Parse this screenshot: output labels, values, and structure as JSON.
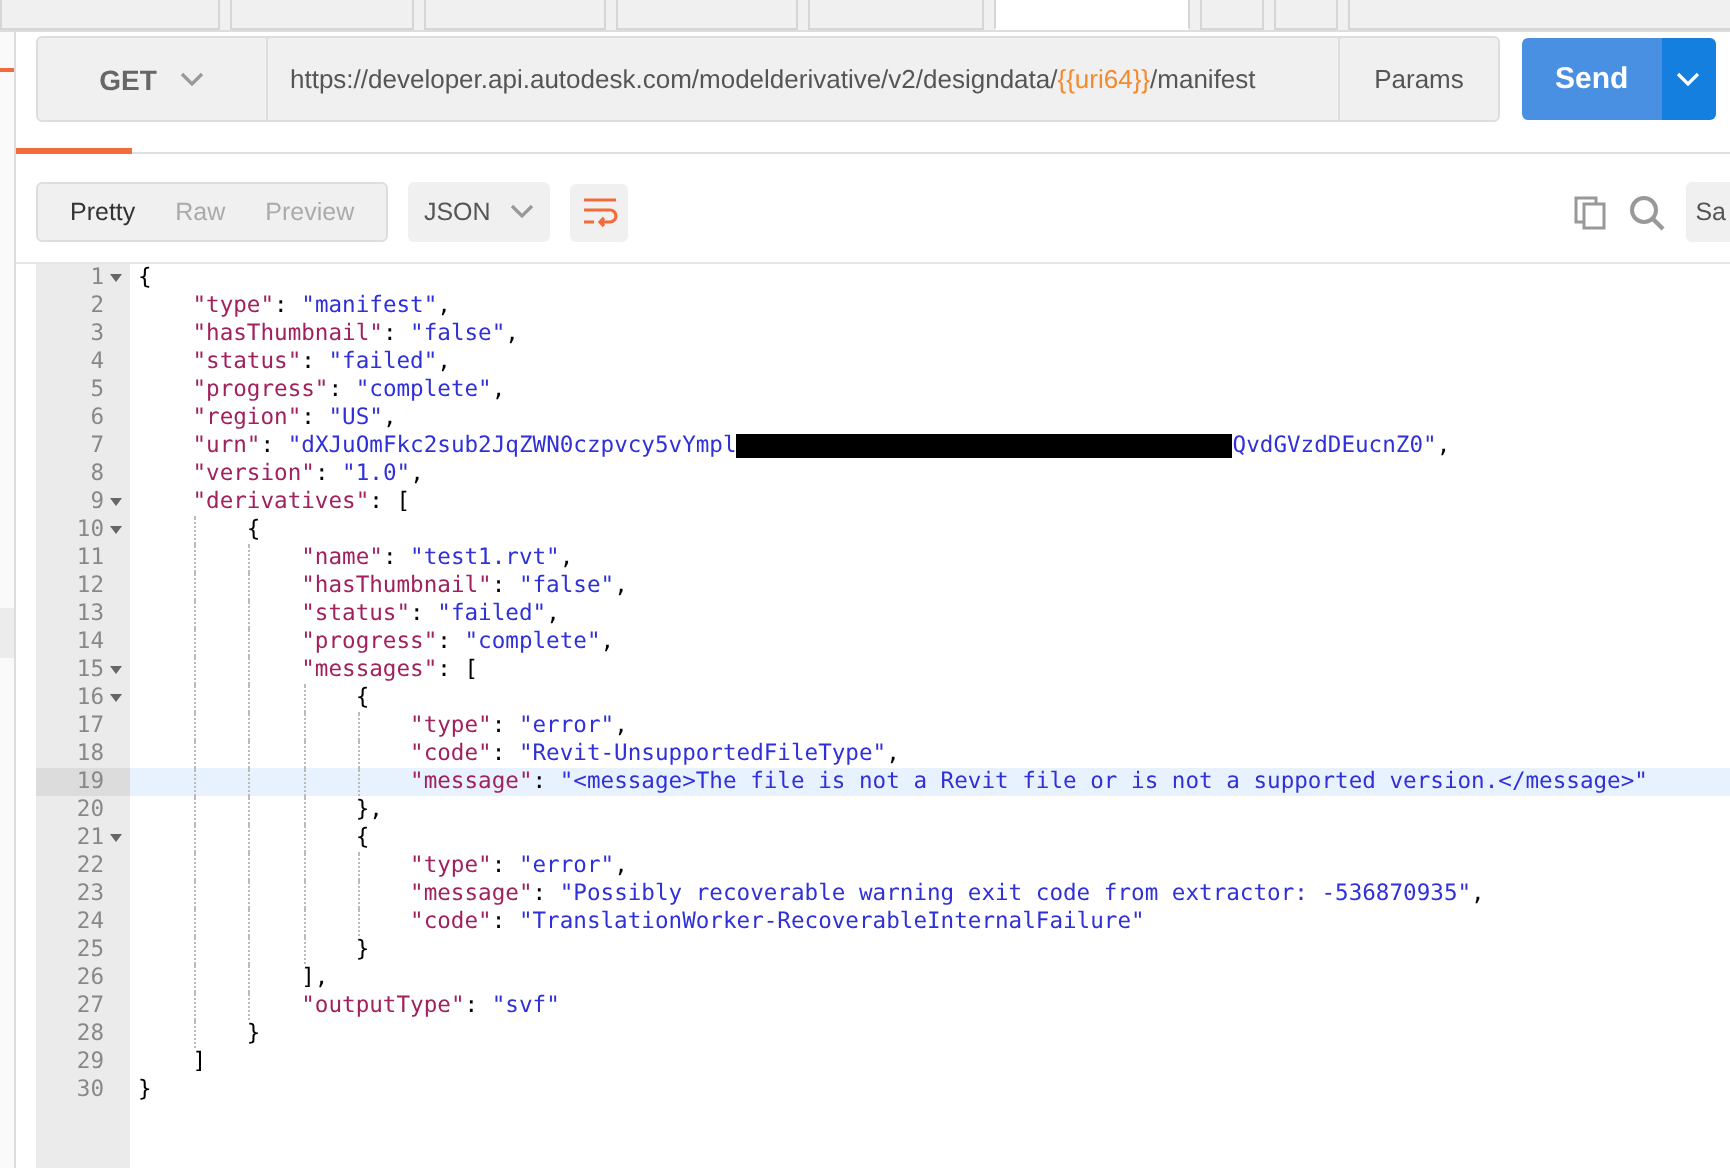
{
  "tabs": [
    {
      "selected": false
    },
    {
      "selected": false
    },
    {
      "selected": false
    },
    {
      "selected": false
    },
    {
      "selected": false
    },
    {
      "selected": true
    },
    {
      "selected": false
    },
    {
      "selected": false
    },
    {
      "selected": false
    }
  ],
  "request": {
    "method": "GET",
    "url_parts": [
      {
        "kind": "text",
        "text": "https://developer.api.autodesk.com/modelderivative/v2/designdata/"
      },
      {
        "kind": "variable",
        "text": "{{uri64}}"
      },
      {
        "kind": "text",
        "text": "/manifest"
      }
    ],
    "params_button": "Params",
    "send_button": "Send"
  },
  "response_toolbar": {
    "view_modes": [
      {
        "label": "Pretty",
        "selected": true
      },
      {
        "label": "Raw",
        "selected": false
      },
      {
        "label": "Preview",
        "selected": false
      }
    ],
    "format": "JSON",
    "wrap_on": true,
    "save_button": "Sa"
  },
  "body": {
    "lines": [
      {
        "number": "1",
        "text": "{",
        "foldable": true,
        "highlighted": false
      },
      {
        "number": "2",
        "text": "    \"type\": \"manifest\",",
        "foldable": false,
        "highlighted": false
      },
      {
        "number": "3",
        "text": "    \"hasThumbnail\": \"false\",",
        "foldable": false,
        "highlighted": false
      },
      {
        "number": "4",
        "text": "    \"status\": \"failed\",",
        "foldable": false,
        "highlighted": false
      },
      {
        "number": "5",
        "text": "    \"progress\": \"complete\",",
        "foldable": false,
        "highlighted": false
      },
      {
        "number": "6",
        "text": "    \"region\": \"US\",",
        "foldable": false,
        "highlighted": false
      },
      {
        "number": "7",
        "text": "    \"urn\": \"dXJuOmFkc2sub2JqZWN0czpvcy5vYmpl",
        "text_after_redaction": "QvdGVzdDEucnZ0\",",
        "foldable": false,
        "highlighted": false
      },
      {
        "number": "8",
        "text": "    \"version\": \"1.0\",",
        "foldable": false,
        "highlighted": false
      },
      {
        "number": "9",
        "text": "    \"derivatives\": [",
        "foldable": true,
        "highlighted": false
      },
      {
        "number": "10",
        "text": "        {",
        "foldable": true,
        "highlighted": false
      },
      {
        "number": "11",
        "text": "            \"name\": \"test1.rvt\",",
        "foldable": false,
        "highlighted": false
      },
      {
        "number": "12",
        "text": "            \"hasThumbnail\": \"false\",",
        "foldable": false,
        "highlighted": false
      },
      {
        "number": "13",
        "text": "            \"status\": \"failed\",",
        "foldable": false,
        "highlighted": false
      },
      {
        "number": "14",
        "text": "            \"progress\": \"complete\",",
        "foldable": false,
        "highlighted": false
      },
      {
        "number": "15",
        "text": "            \"messages\": [",
        "foldable": true,
        "highlighted": false
      },
      {
        "number": "16",
        "text": "                {",
        "foldable": true,
        "highlighted": false
      },
      {
        "number": "17",
        "text": "                    \"type\": \"error\",",
        "foldable": false,
        "highlighted": false
      },
      {
        "number": "18",
        "text": "                    \"code\": \"Revit-UnsupportedFileType\",",
        "foldable": false,
        "highlighted": false
      },
      {
        "number": "19",
        "text": "                    \"message\": \"<message>The file is not a Revit file or is not a supported version.</message>\"",
        "foldable": false,
        "highlighted": true
      },
      {
        "number": "20",
        "text": "                },",
        "foldable": false,
        "highlighted": false
      },
      {
        "number": "21",
        "text": "                {",
        "foldable": true,
        "highlighted": false
      },
      {
        "number": "22",
        "text": "                    \"type\": \"error\",",
        "foldable": false,
        "highlighted": false
      },
      {
        "number": "23",
        "text": "                    \"message\": \"Possibly recoverable warning exit code from extractor: -536870935\",",
        "foldable": false,
        "highlighted": false
      },
      {
        "number": "24",
        "text": "                    \"code\": \"TranslationWorker-RecoverableInternalFailure\"",
        "foldable": false,
        "highlighted": false
      },
      {
        "number": "25",
        "text": "                }",
        "foldable": false,
        "highlighted": false
      },
      {
        "number": "26",
        "text": "            ],",
        "foldable": false,
        "highlighted": false
      },
      {
        "number": "27",
        "text": "            \"outputType\": \"svf\"",
        "foldable": false,
        "highlighted": false
      },
      {
        "number": "28",
        "text": "        }",
        "foldable": false,
        "highlighted": false
      },
      {
        "number": "29",
        "text": "    ]",
        "foldable": false,
        "highlighted": false
      },
      {
        "number": "30",
        "text": "}",
        "foldable": false,
        "highlighted": false
      }
    ]
  }
}
